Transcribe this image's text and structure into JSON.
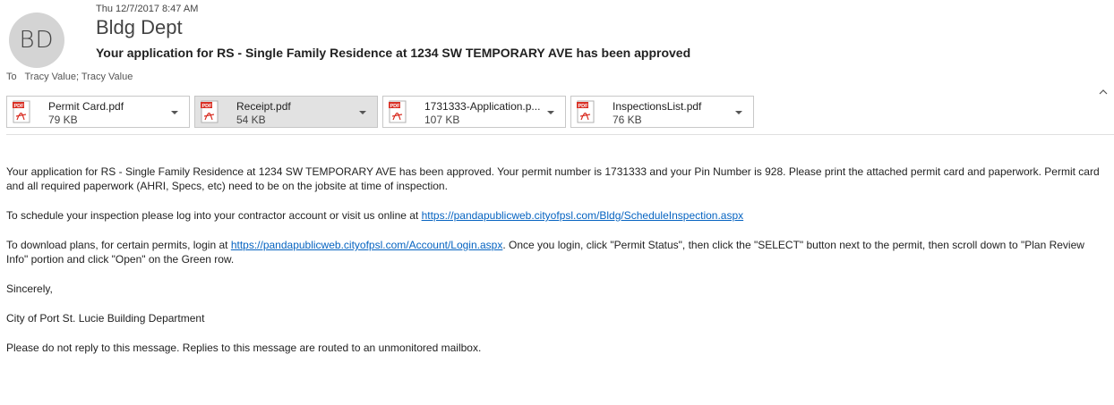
{
  "email": {
    "date": "Thu 12/7/2017 8:47 AM",
    "avatar_initials": "BD",
    "sender": "Bldg Dept",
    "subject": "Your application for RS - Single Family Residence at 1234 SW TEMPORARY AVE has been approved",
    "to_label": "To",
    "recipients": "Tracy Value; Tracy Value",
    "collapse_icon": "chevron-up-icon"
  },
  "attachments": [
    {
      "name": "Permit Card.pdf",
      "size": "79 KB",
      "icon": "pdf-icon"
    },
    {
      "name": "Receipt.pdf",
      "size": "54 KB",
      "icon": "pdf-icon",
      "selected": true
    },
    {
      "name": "1731333-Application.p...",
      "size": "107 KB",
      "icon": "pdf-icon"
    },
    {
      "name": "InspectionsList.pdf",
      "size": "76 KB",
      "icon": "pdf-icon"
    }
  ],
  "body": {
    "p1": "Your application for RS - Single Family Residence at 1234 SW TEMPORARY AVE has been approved. Your permit number is 1731333 and your Pin Number is 928. Please print the attached permit card and paperwork. Permit card and all required paperwork (AHRI, Specs, etc) need to be on the jobsite at time of inspection.",
    "p2_prefix": "To schedule your inspection please log into your contractor account or visit us online at ",
    "p2_link": "https://pandapublicweb.cityofpsl.com/Bldg/ScheduleInspection.aspx",
    "p3_prefix": "To download plans, for certain permits, login at ",
    "p3_link": "https://pandapublicweb.cityofpsl.com/Account/Login.aspx",
    "p3_suffix": ". Once you login, click \"Permit Status\", then click the \"SELECT\" button next to the permit, then scroll down to \"Plan Review Info\" portion and click \"Open\" on the Green row.",
    "closing": "Sincerely,",
    "signature": "City of Port St. Lucie Building Department",
    "footer": "Please do not reply to this message. Replies to this message are routed to an unmonitored mailbox."
  },
  "colors": {
    "link": "#0563c1",
    "pdf_red": "#d93025",
    "avatar_bg": "#d4d4d4"
  }
}
